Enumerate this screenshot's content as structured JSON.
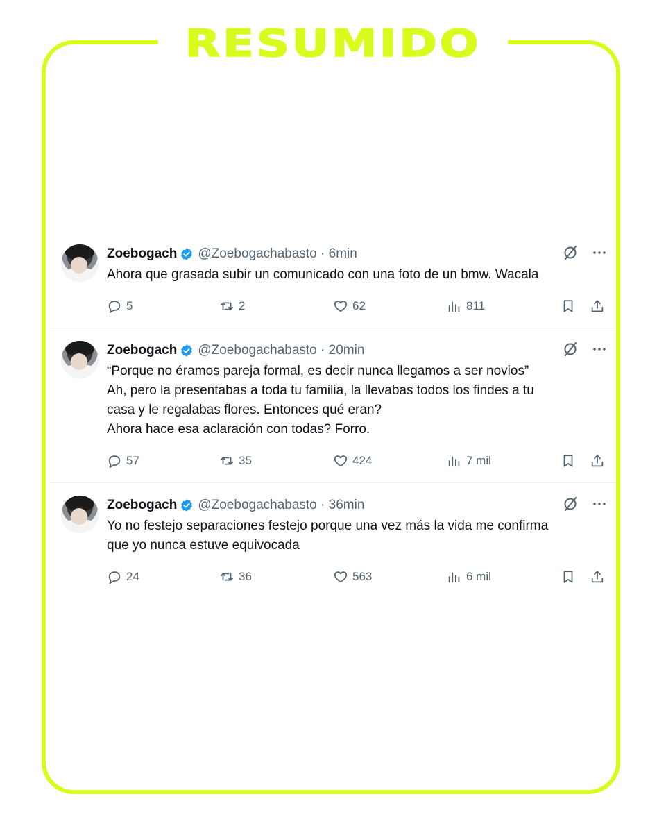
{
  "brand": {
    "title": "RESUMIDO",
    "color": "#d9fb1e"
  },
  "tweets": [
    {
      "name": "Zoebogach",
      "handle": "@Zoebogachabasto",
      "time": "6min",
      "lines": [
        "Ahora que grasada subir un comunicado con una foto de un bmw. Wacala"
      ],
      "replies": "5",
      "retweets": "2",
      "likes": "62",
      "views": "811"
    },
    {
      "name": "Zoebogach",
      "handle": "@Zoebogachabasto",
      "time": "20min",
      "lines": [
        "“Porque no éramos pareja formal, es decir nunca llegamos a ser novios”",
        "Ah, pero la presentabas a toda tu familia, la llevabas todos los findes a tu",
        "casa y le regalabas flores. Entonces qué eran?",
        "Ahora hace esa aclaración con todas? Forro."
      ],
      "replies": "57",
      "retweets": "35",
      "likes": "424",
      "views": "7 mil"
    },
    {
      "name": "Zoebogach",
      "handle": "@Zoebogachabasto",
      "time": "36min",
      "lines": [
        "Yo no festejo separaciones festejo porque una vez más la vida me confirma",
        "que yo nunca estuve equivocada"
      ],
      "replies": "24",
      "retweets": "36",
      "likes": "563",
      "views": "6 mil"
    }
  ],
  "icons": {
    "verified": "verified-badge-icon",
    "grok": "grok-icon",
    "more": "more-icon",
    "reply": "reply-icon",
    "retweet": "retweet-icon",
    "like": "heart-icon",
    "views": "views-icon",
    "bookmark": "bookmark-icon",
    "share": "share-icon"
  },
  "colors": {
    "verified": "#1d9bf0",
    "text": "#0f1419",
    "muted": "#536471"
  }
}
